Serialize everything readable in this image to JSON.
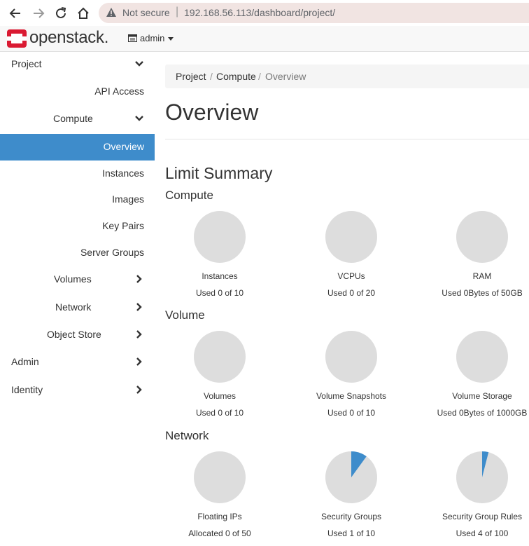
{
  "browser": {
    "security_label": "Not secure",
    "separator": "|",
    "url": "192.168.56.113/dashboard/project/"
  },
  "header": {
    "brand": "openstack.",
    "project_menu": "admin"
  },
  "sidebar": {
    "items": [
      {
        "label": "Project",
        "chevron": "down"
      },
      {
        "label": "API Access"
      },
      {
        "label": "Compute",
        "chevron": "down"
      },
      {
        "label": "Overview",
        "active": true
      },
      {
        "label": "Instances"
      },
      {
        "label": "Images"
      },
      {
        "label": "Key Pairs"
      },
      {
        "label": "Server Groups"
      },
      {
        "label": "Volumes",
        "chevron": "right"
      },
      {
        "label": "Network",
        "chevron": "right"
      },
      {
        "label": "Object Store",
        "chevron": "right"
      },
      {
        "label": "Admin",
        "chevron": "right"
      },
      {
        "label": "Identity",
        "chevron": "right"
      }
    ]
  },
  "breadcrumb": {
    "items": [
      "Project",
      "Compute",
      "Overview"
    ],
    "separator": "/"
  },
  "page": {
    "title": "Overview",
    "limit_summary": "Limit Summary"
  },
  "colors": {
    "active_nav": "#3e8ccb",
    "pie_empty": "#dddddd",
    "pie_used": "#3e8ccb"
  },
  "groups": [
    {
      "title": "Compute",
      "charts": [
        {
          "title": "Instances",
          "used_text": "Used 0 of 10",
          "used": 0,
          "limit": 10
        },
        {
          "title": "VCPUs",
          "used_text": "Used 0 of 20",
          "used": 0,
          "limit": 20
        },
        {
          "title": "RAM",
          "used_text": "Used 0Bytes of 50GB",
          "used": 0,
          "limit": 50
        }
      ]
    },
    {
      "title": "Volume",
      "charts": [
        {
          "title": "Volumes",
          "used_text": "Used 0 of 10",
          "used": 0,
          "limit": 10
        },
        {
          "title": "Volume Snapshots",
          "used_text": "Used 0 of 10",
          "used": 0,
          "limit": 10
        },
        {
          "title": "Volume Storage",
          "used_text": "Used 0Bytes of 1000GB",
          "used": 0,
          "limit": 1000
        }
      ]
    },
    {
      "title": "Network",
      "charts": [
        {
          "title": "Floating IPs",
          "used_text": "Allocated 0 of 50",
          "used": 0,
          "limit": 50
        },
        {
          "title": "Security Groups",
          "used_text": "Used 1 of 10",
          "used": 1,
          "limit": 10
        },
        {
          "title": "Security Group Rules",
          "used_text": "Used 4 of 100",
          "used": 4,
          "limit": 100
        }
      ]
    }
  ]
}
